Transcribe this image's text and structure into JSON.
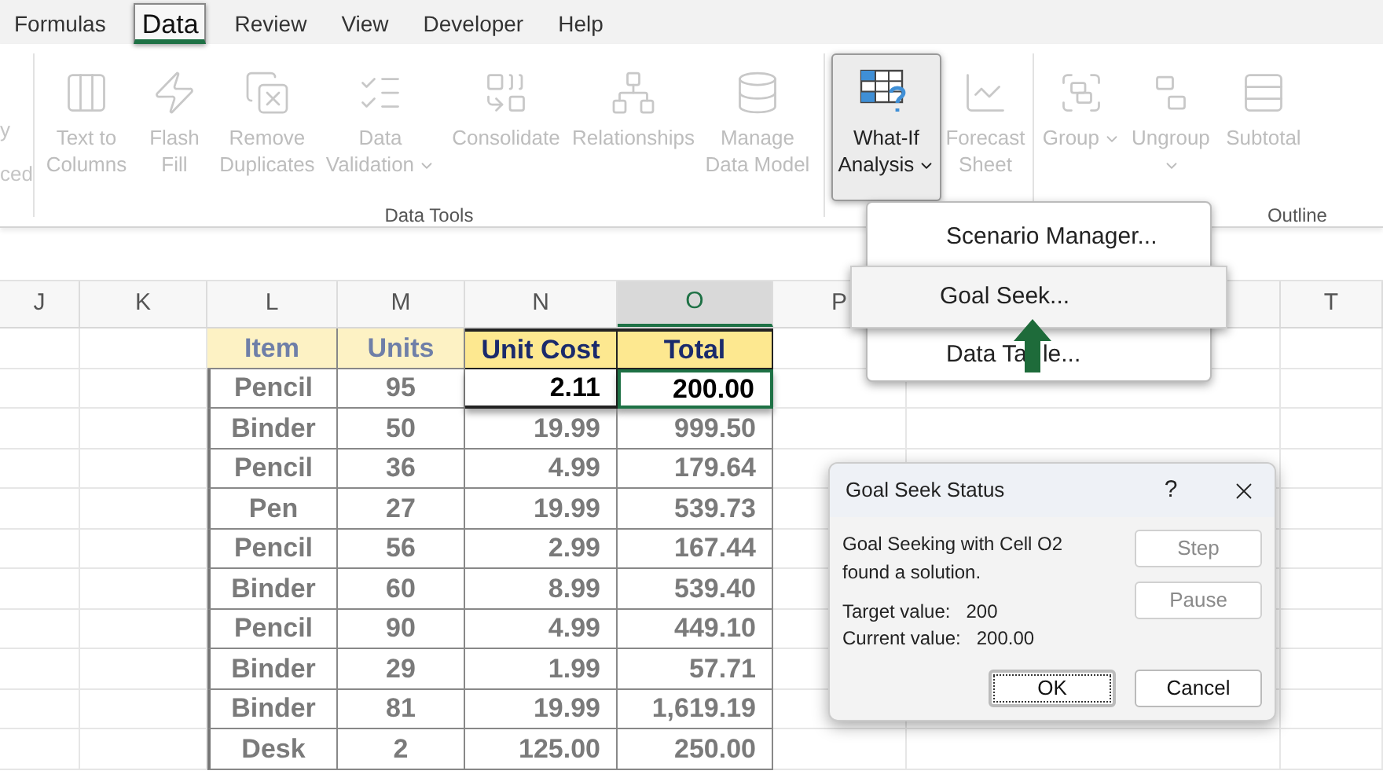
{
  "tabs": [
    {
      "label": "Formulas",
      "selected": false
    },
    {
      "label": "Data",
      "selected": true
    },
    {
      "label": "Review",
      "selected": false
    },
    {
      "label": "View",
      "selected": false
    },
    {
      "label": "Developer",
      "selected": false
    },
    {
      "label": "Help",
      "selected": false
    }
  ],
  "ribbon": {
    "partial_group": {
      "lines": [
        "y",
        "ced"
      ]
    },
    "groups": [
      {
        "label": "Data Tools",
        "buttons": [
          {
            "label": "Text to Columns",
            "disabled": true,
            "dropdown": false,
            "pressed": false
          },
          {
            "label": "Flash Fill",
            "disabled": true,
            "dropdown": false,
            "pressed": false
          },
          {
            "label": "Remove Duplicates",
            "disabled": true,
            "dropdown": false,
            "pressed": false
          },
          {
            "label": "Data Validation",
            "disabled": true,
            "dropdown": true,
            "pressed": false
          },
          {
            "label": "Consolidate",
            "disabled": true,
            "dropdown": false,
            "pressed": false
          },
          {
            "label": "Relationships",
            "disabled": true,
            "dropdown": false,
            "pressed": false
          },
          {
            "label": "Manage Data Model",
            "disabled": true,
            "dropdown": false,
            "pressed": false
          }
        ]
      },
      {
        "buttons": [
          {
            "label": "What-If Analysis",
            "disabled": false,
            "dropdown": true,
            "pressed": true
          },
          {
            "label": "Forecast Sheet",
            "disabled": true,
            "dropdown": false,
            "pressed": false
          }
        ]
      },
      {
        "label": "Outline",
        "buttons": [
          {
            "label": "Group",
            "disabled": true,
            "dropdown": true,
            "pressed": false
          },
          {
            "label": "Ungroup",
            "disabled": true,
            "dropdown": true,
            "pressed": false
          },
          {
            "label": "Subtotal",
            "disabled": true,
            "dropdown": false,
            "pressed": false
          }
        ]
      }
    ]
  },
  "sheet": {
    "columns": [
      {
        "label": "J",
        "selected": false
      },
      {
        "label": "K",
        "selected": false
      },
      {
        "label": "L",
        "selected": false
      },
      {
        "label": "M",
        "selected": false
      },
      {
        "label": "N",
        "selected": false
      },
      {
        "label": "O",
        "selected": true
      },
      {
        "label": "P",
        "selected": false
      },
      {
        "label": "T",
        "selected": false
      }
    ]
  },
  "table": {
    "columns": [
      {
        "label": "Item",
        "highlighted": false
      },
      {
        "label": "Units",
        "highlighted": false
      },
      {
        "label": "Unit Cost",
        "highlighted": true
      },
      {
        "label": "Total",
        "highlighted": true
      }
    ],
    "rows": [
      {
        "cells": [
          "Pencil",
          "95",
          "2.11",
          "200.00"
        ],
        "highlighted": true,
        "selected": true
      },
      {
        "cells": [
          "Binder",
          "50",
          "19.99",
          "999.50"
        ],
        "highlighted": false,
        "selected": false
      },
      {
        "cells": [
          "Pencil",
          "36",
          "4.99",
          "179.64"
        ],
        "highlighted": false,
        "selected": false
      },
      {
        "cells": [
          "Pen",
          "27",
          "19.99",
          "539.73"
        ],
        "highlighted": false,
        "selected": false
      },
      {
        "cells": [
          "Pencil",
          "56",
          "2.99",
          "167.44"
        ],
        "highlighted": false,
        "selected": false
      },
      {
        "cells": [
          "Binder",
          "60",
          "8.99",
          "539.40"
        ],
        "highlighted": false,
        "selected": false
      },
      {
        "cells": [
          "Pencil",
          "90",
          "4.99",
          "449.10"
        ],
        "highlighted": false,
        "selected": false
      },
      {
        "cells": [
          "Binder",
          "29",
          "1.99",
          "57.71"
        ],
        "highlighted": false,
        "selected": false
      },
      {
        "cells": [
          "Binder",
          "81",
          "19.99",
          "1,619.19"
        ],
        "highlighted": false,
        "selected": false
      },
      {
        "cells": [
          "Desk",
          "2",
          "125.00",
          "250.00"
        ],
        "highlighted": false,
        "selected": false
      }
    ]
  },
  "menu": {
    "items": [
      {
        "label": "Scenario Manager...",
        "selected": false
      },
      {
        "label": "Goal Seek...",
        "selected": true
      },
      {
        "label": "Data Ta",
        "label_after_arrow": "le...",
        "selected": false
      }
    ]
  },
  "dialog": {
    "title": "Goal Seek Status",
    "help": "?",
    "message": "Goal Seeking with Cell O2 found a solution.",
    "fields": [
      {
        "label": "Target value:",
        "value": "200"
      },
      {
        "label": "Current value:",
        "value": "200.00"
      }
    ],
    "buttons": [
      {
        "label": "Step",
        "disabled": true,
        "default": false
      },
      {
        "label": "Pause",
        "disabled": true,
        "default": false
      },
      {
        "label": "OK",
        "disabled": false,
        "default": true
      },
      {
        "label": "Cancel",
        "disabled": false,
        "default": false
      }
    ]
  }
}
